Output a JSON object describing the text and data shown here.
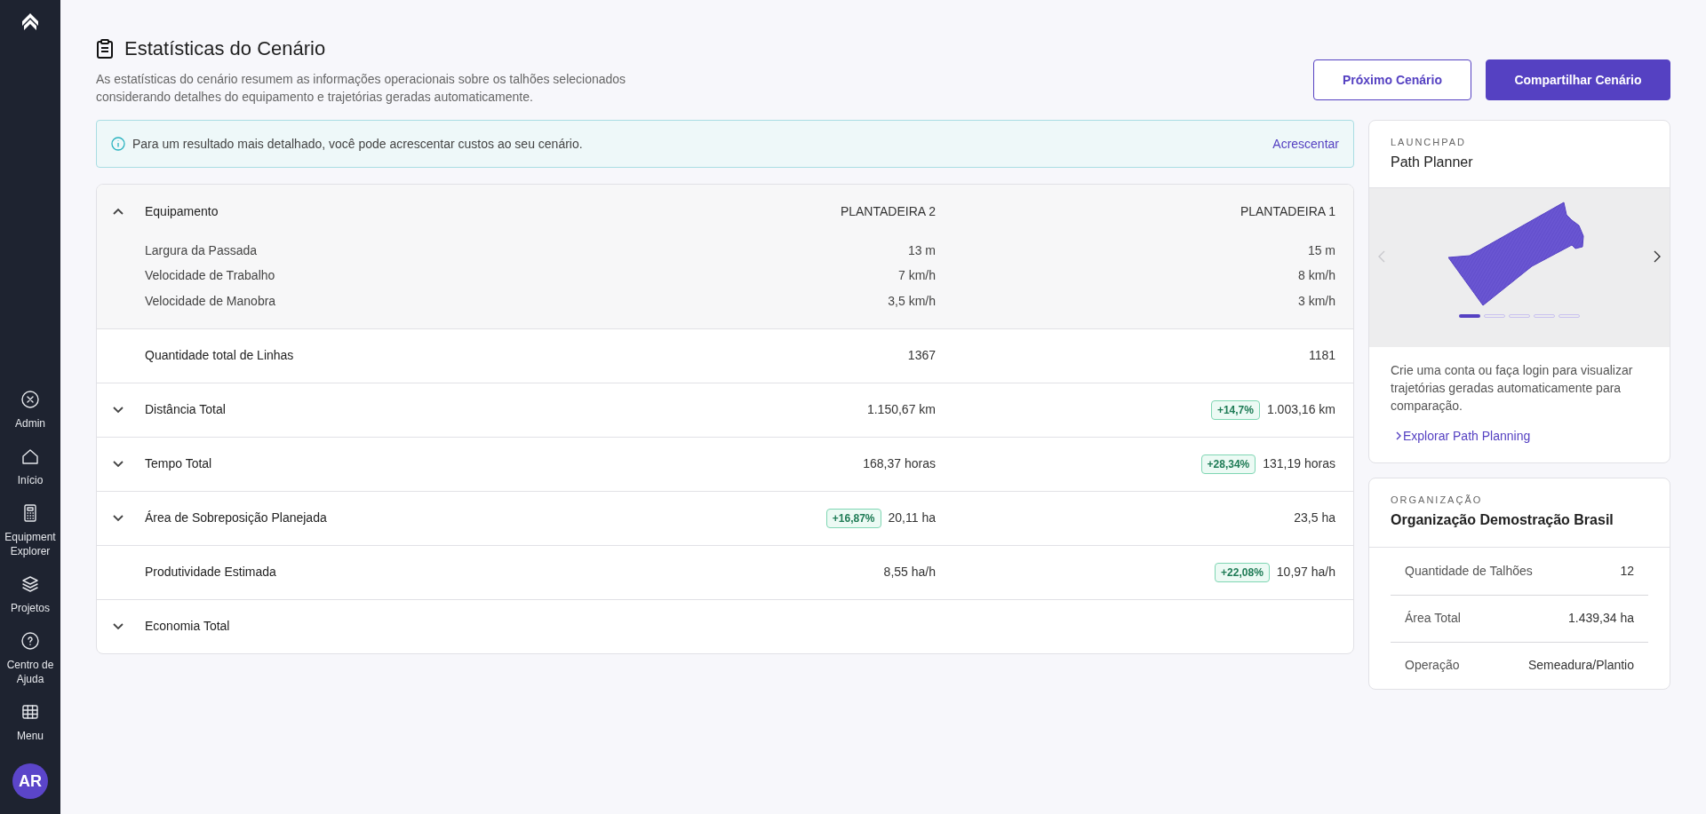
{
  "sidebar": {
    "items": [
      {
        "label": "Admin"
      },
      {
        "label": "Início"
      },
      {
        "label": "Equipment Explorer"
      },
      {
        "label": "Projetos"
      },
      {
        "label": "Centro de Ajuda"
      },
      {
        "label": "Menu"
      }
    ],
    "avatar": {
      "initials": "AR"
    }
  },
  "header": {
    "title": "Estatísticas do Cenário",
    "description": "As estatísticas do cenário resumem as informações operacionais sobre os talhões selecionados considerando detalhes do equipamento e trajetórias geradas automaticamente.",
    "buttons": [
      {
        "label": "Próximo Cenário",
        "kind": "outline"
      },
      {
        "label": "Compartilhar Cenário",
        "kind": "primary"
      }
    ]
  },
  "banner": {
    "text": "Para um resultado mais detalhado, você pode acrescentar custos ao seu cenário.",
    "action": "Acrescentar"
  },
  "table": {
    "rows": [
      {
        "kind": "expandable",
        "label": "Equipamento",
        "expanded": true,
        "cells": [
          {
            "value": "PLANTADEIRA 2"
          },
          {
            "value": "PLANTADEIRA 1"
          }
        ],
        "children": [
          {
            "label": "Largura da Passada",
            "cells": [
              {
                "value": "13 m"
              },
              {
                "value": "15 m"
              }
            ]
          },
          {
            "label": "Velocidade de Trabalho",
            "cells": [
              {
                "value": "7 km/h"
              },
              {
                "value": "8 km/h"
              }
            ]
          },
          {
            "label": "Velocidade de Manobra",
            "cells": [
              {
                "value": "3,5 km/h"
              },
              {
                "value": "3 km/h"
              }
            ]
          }
        ]
      },
      {
        "kind": "plain",
        "label": "Quantidade total de Linhas",
        "cells": [
          {
            "value": "1367"
          },
          {
            "value": "1181"
          }
        ]
      },
      {
        "kind": "expandable",
        "label": "Distância Total",
        "expanded": false,
        "cells": [
          {
            "value": "1.150,67 km"
          },
          {
            "value": "1.003,16 km",
            "badge": "+14,7%"
          }
        ]
      },
      {
        "kind": "expandable",
        "label": "Tempo Total",
        "expanded": false,
        "cells": [
          {
            "value": "168,37 horas"
          },
          {
            "value": "131,19 horas",
            "badge": "+28,34%"
          }
        ]
      },
      {
        "kind": "expandable",
        "label": "Área de Sobreposição Planejada",
        "expanded": false,
        "cells": [
          {
            "value": "20,11 ha",
            "badge": "+16,87%"
          },
          {
            "value": "23,5 ha"
          }
        ]
      },
      {
        "kind": "plain",
        "label": "Produtividade Estimada",
        "cells": [
          {
            "value": "8,55 ha/h"
          },
          {
            "value": "10,97 ha/h",
            "badge": "+22,08%"
          }
        ]
      },
      {
        "kind": "expandable",
        "label": "Economia Total",
        "expanded": false,
        "cells": []
      }
    ]
  },
  "launchpad": {
    "eyebrow": "LAUNCHPAD",
    "title": "Path Planner",
    "carousel": {
      "prev_disabled": true,
      "dots": [
        {
          "selected": true
        },
        {
          "selected": false
        },
        {
          "selected": false
        },
        {
          "selected": false
        },
        {
          "selected": false
        }
      ]
    },
    "text": "Crie uma conta ou faça login para visualizar trajetórias geradas automaticamente para comparação.",
    "link": "Explorar Path Planning"
  },
  "organization": {
    "eyebrow": "ORGANIZAÇÃO",
    "title": "Organização Demostração Brasil",
    "rows": [
      {
        "label": "Quantidade de Talhões",
        "value": "12"
      },
      {
        "label": "Área Total",
        "value": "1.439,34 ha"
      },
      {
        "label": "Operação",
        "value": "Semeadura/Plantio"
      }
    ]
  }
}
